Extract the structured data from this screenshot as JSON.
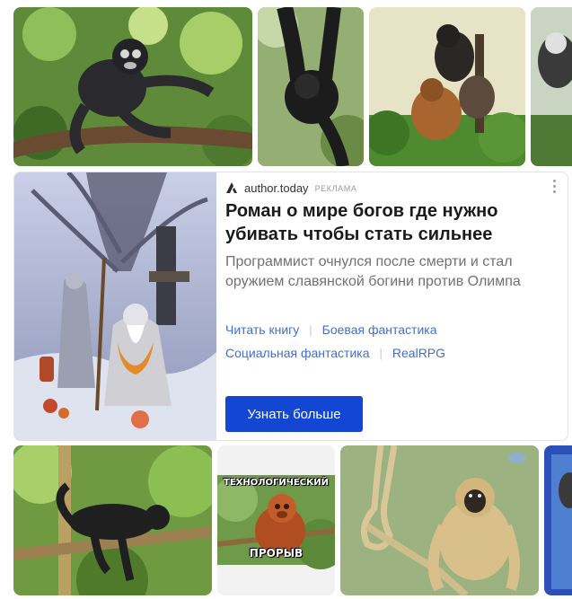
{
  "top_row": [
    {
      "name": "monkey-image-1",
      "alt": "dusky leaf monkey on branch"
    },
    {
      "name": "monkey-image-2",
      "alt": "black monkey hanging"
    },
    {
      "name": "monkey-image-3",
      "alt": "howler monkeys on tree"
    },
    {
      "name": "monkey-image-4",
      "alt": "monkey partial"
    }
  ],
  "ad": {
    "source": "author.today",
    "label": "РЕКЛАМА",
    "title": "Роман о мире богов где нужно убивать чтобы стать сильнее",
    "description": "Программист очнулся после смерти и стал оружием славянской богини против Олимпа",
    "tags_row1": [
      "Читать книгу",
      "Боевая фантастика"
    ],
    "tags_row2": [
      "Социальная фантастика",
      "RealRPG"
    ],
    "tag_separator": "|",
    "cta": "Узнать больше",
    "colors": {
      "cta": "#1446d4",
      "link": "#3f6fd0"
    }
  },
  "bottom_row": [
    {
      "name": "monkey-image-5",
      "alt": "black monkey on branch"
    },
    {
      "name": "meme-image",
      "caption_top": "ТЕХНОЛОГИЧЕСКИЙ",
      "caption_bottom": "ПРОРЫВ"
    },
    {
      "name": "monkey-image-7",
      "alt": "howler monkey with rope"
    },
    {
      "name": "monkey-image-8",
      "alt": "partial image"
    }
  ]
}
